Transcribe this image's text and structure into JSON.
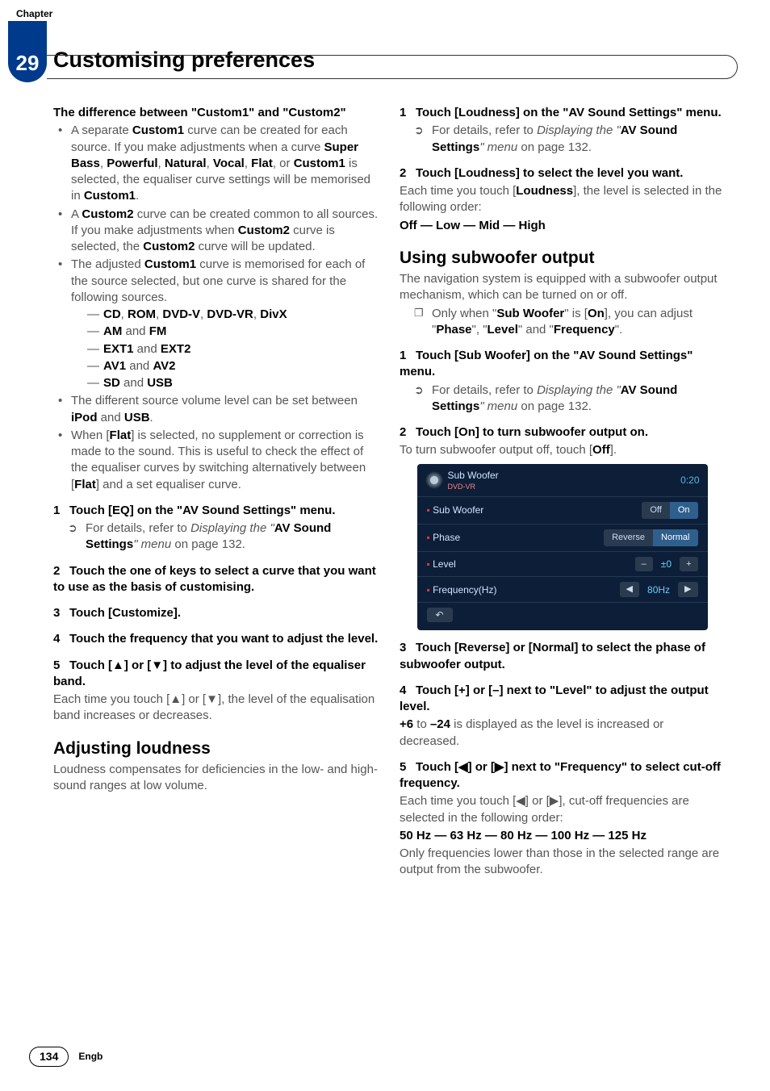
{
  "header": {
    "chapter_label": "Chapter",
    "num": "29",
    "title": "Customising preferences"
  },
  "left": {
    "diff_heading": "The difference between \"Custom1\" and \"Custom2\"",
    "b1_a": "A separate ",
    "b1_b": "Custom1",
    "b1_c": " curve can be created for each source. If you make adjustments when a curve ",
    "b1_d": "Super Bass",
    "b1_e": ", ",
    "b1_f": "Powerful",
    "b1_g": ", ",
    "b1_h": "Natural",
    "b1_i": ", ",
    "b1_j": "Vocal",
    "b1_k": ", ",
    "b1_l": "Flat",
    "b1_m": ", or ",
    "b1_n": "Custom1",
    "b1_o": " is selected, the equaliser curve settings will be memorised in ",
    "b1_p": "Custom1",
    "b1_q": ".",
    "b2_a": "A ",
    "b2_b": "Custom2",
    "b2_c": " curve can be created common to all sources. If you make adjustments when ",
    "b2_d": "Custom2",
    "b2_e": " curve is selected, the ",
    "b2_f": "Custom2",
    "b2_g": " curve will be updated.",
    "b3_a": "The adjusted ",
    "b3_b": "Custom1",
    "b3_c": " curve is memorised for each of the source selected, but one curve is shared for the following sources.",
    "d1a": "CD",
    "d1b": "ROM",
    "d1c": "DVD-V",
    "d1d": "DVD-VR",
    "d1e": "DivX",
    "d2a": "AM",
    "d2and": " and ",
    "d2b": "FM",
    "d3a": "EXT1",
    "d3and": " and ",
    "d3b": "EXT2",
    "d4a": "AV1",
    "d4and": " and ",
    "d4b": "AV2",
    "d5a": "SD",
    "d5and": " and ",
    "d5b": "USB",
    "b4_a": "The different source volume level can be set between ",
    "b4_b": "iPod",
    "b4_c": " and ",
    "b4_d": "USB",
    "b4_e": ".",
    "b5_a": "When [",
    "b5_b": "Flat",
    "b5_c": "] is selected, no supplement or correction is made to the sound. This is useful to check the effect of the equaliser curves by switching alternatively between [",
    "b5_d": "Flat",
    "b5_e": "] and a set equaliser curve.",
    "s1": "Touch [EQ] on the \"AV Sound Settings\" menu.",
    "s1_note_a": "For details, refer to ",
    "s1_note_i": "Displaying the \"",
    "s1_note_b": "AV Sound Settings",
    "s1_note_i2": "\" menu",
    "s1_note_c": " on page 132.",
    "s2": "Touch the one of keys to select a curve that you want to use as the basis of customising.",
    "s3": "Touch [Customize].",
    "s4": "Touch the frequency that you want to adjust the level.",
    "s5": "Touch [▲] or [▼] to adjust the level of the equaliser band.",
    "s5_body": "Each time you touch [▲] or [▼], the level of the equalisation band increases or decreases.",
    "h_loud": "Adjusting loudness",
    "loud_body": "Loudness compensates for deficiencies in the low- and high-sound ranges at low volume."
  },
  "right": {
    "r1": "Touch [Loudness] on the \"AV Sound Settings\" menu.",
    "r1_note_a": "For details, refer to ",
    "r1_note_i": "Displaying the \"",
    "r1_note_b": "AV Sound Settings",
    "r1_note_i2": "\" menu",
    "r1_note_c": " on page 132.",
    "r2": "Touch [Loudness] to select the level you want.",
    "r2_body_a": "Each time you touch [",
    "r2_body_b": "Loudness",
    "r2_body_c": "], the level is selected in the following order:",
    "r2_seq": "Off — Low — Mid — High",
    "h_sub": "Using subwoofer output",
    "sub_body": "The navigation system is equipped with a subwoofer output mechanism, which can be turned on or off.",
    "sub_note_a": "Only when \"",
    "sub_note_b": "Sub Woofer",
    "sub_note_c": "\" is [",
    "sub_note_d": "On",
    "sub_note_e": "], you can adjust \"",
    "sub_note_f": "Phase",
    "sub_note_g": "\", \"",
    "sub_note_h": "Level",
    "sub_note_i": "\" and \"",
    "sub_note_j": "Frequency",
    "sub_note_k": "\".",
    "rs1": "Touch [Sub Woofer] on the \"AV Sound Settings\" menu.",
    "rs1_note_a": "For details, refer to ",
    "rs1_note_i": "Displaying the \"",
    "rs1_note_b": "AV Sound Settings",
    "rs1_note_i2": "\" menu",
    "rs1_note_c": " on page 132.",
    "rs2": "Touch [On] to turn subwoofer output on.",
    "rs2_body_a": "To turn subwoofer output off, touch [",
    "rs2_body_b": "Off",
    "rs2_body_c": "].",
    "rs3": "Touch [Reverse] or [Normal] to select the phase of subwoofer output.",
    "rs4": "Touch [+] or [–] next to \"Level\" to adjust the output level.",
    "rs4_body_a": "+6",
    "rs4_body_b": " to ",
    "rs4_body_c": "–24",
    "rs4_body_d": " is displayed as the level is increased or decreased.",
    "rs5": "Touch [◀] or [▶] next to \"Frequency\" to select cut-off frequency.",
    "rs5_body": "Each time you touch [◀] or [▶], cut-off frequencies are selected in the following order:",
    "rs5_seq": "50 Hz — 63 Hz — 80 Hz — 100 Hz — 125 Hz",
    "rs5_tail": "Only frequencies lower than those in the selected range are output from the subwoofer."
  },
  "shot": {
    "title": "Sub Woofer",
    "src": "DVD-VR",
    "time": "0:20",
    "row1": "Sub Woofer",
    "off": "Off",
    "on": "On",
    "row2": "Phase",
    "rev": "Reverse",
    "norm": "Normal",
    "row3": "Level",
    "minus": "–",
    "zero": "±0",
    "plus": "+",
    "row4": "Frequency(Hz)",
    "left": "◀",
    "freq": "80Hz",
    "right": "▶",
    "back": "↶"
  },
  "footer": {
    "page": "134",
    "lang": "Engb"
  }
}
